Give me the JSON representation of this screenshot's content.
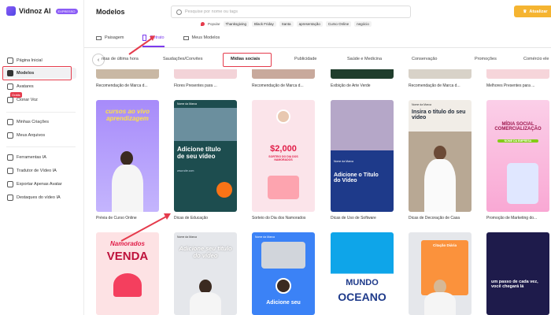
{
  "brand": {
    "name": "Vidnoz AI",
    "badge": "EXPRESSO"
  },
  "sidebar": {
    "items": [
      {
        "label": "Página Inicial",
        "icon": "home-icon"
      },
      {
        "label": "Modelos",
        "icon": "templates-icon"
      },
      {
        "label": "Avatares",
        "icon": "avatar-icon"
      },
      {
        "label": "Clonar Voz",
        "icon": "microphone-icon"
      },
      {
        "label": "Minhas Criações",
        "icon": "creations-icon"
      },
      {
        "label": "Meus Arquivos",
        "icon": "folder-icon"
      },
      {
        "label": "Ferramentas IA",
        "icon": "tools-icon"
      },
      {
        "label": "Tradutor de Vídeo IA",
        "icon": "translate-icon"
      },
      {
        "label": "Exportar Apenas Avatar",
        "icon": "export-icon"
      },
      {
        "label": "Destaques do vídeo IA",
        "icon": "highlight-icon"
      }
    ],
    "gratis_badge": "Grátis"
  },
  "header": {
    "title": "Modelos",
    "search_placeholder": "Pesquise por nome ou tags",
    "popular_label": "Popular",
    "popular_tags": [
      "Thanksgiving",
      "Black Friday",
      "Santa",
      "apresentação",
      "Curso Online",
      "negócio"
    ],
    "upgrade_label": "Atualizar"
  },
  "orientation_tabs": [
    {
      "label": "Paisagem",
      "active": false
    },
    {
      "label": "Retrato",
      "active": true
    },
    {
      "label": "Meus Modelos",
      "active": false
    }
  ],
  "categories": [
    "ntas de última hora",
    "Saudações/Convites",
    "Mídias sociais",
    "Publicidade",
    "Saúde e Medicina",
    "Conservação",
    "Promoções",
    "Comércio ele"
  ],
  "active_category": "Mídias sociais",
  "row0_captions": [
    "Recomendação de Marca d...",
    "Flores Presentes para ...",
    "Recomendação de Marca d...",
    "Exibição de Arte Verde",
    "Recomendação de Marca d...",
    "Melhores Presentes para ..."
  ],
  "row1": [
    {
      "caption": "Prévia de Curso Online",
      "text": "cursos ao vivo aprendizagem"
    },
    {
      "caption": "Dicas de Educação",
      "text": "Adicione título de seu vídeo",
      "brand": "Nome da Marca",
      "url": "www.site.com"
    },
    {
      "caption": "Sorteio do Dia dos Namorados",
      "text": "$2,000",
      "sub": "SORTEIO DO DIA DOS NAMORADOS"
    },
    {
      "caption": "Dicas de Uso de Software",
      "text": "Adicione o Título do Vídeo",
      "brand": "Nome da Marca"
    },
    {
      "caption": "Dicas de Decoração de Casa",
      "text": "Insira o título do seu vídeo",
      "brand": "Nome da Marca"
    },
    {
      "caption": "Promoção de Marketing do...",
      "text": "MÍDIA SOCIAL COMERCIALIZAÇÃO",
      "sub": "NOME DA EMPRESA"
    }
  ],
  "row2": [
    {
      "text1": "Namorados",
      "text2": "VENDA"
    },
    {
      "text": "Adicione seu título do vídeo",
      "brand": "Nome da Marca"
    },
    {
      "text": "Adicione seu",
      "brand": "Nome da Marca"
    },
    {
      "text1": "MUNDO",
      "text2": "OCEANO"
    },
    {
      "text": "Citação Diária"
    },
    {
      "text": "um passo de cada vez, você chegará lá"
    }
  ]
}
